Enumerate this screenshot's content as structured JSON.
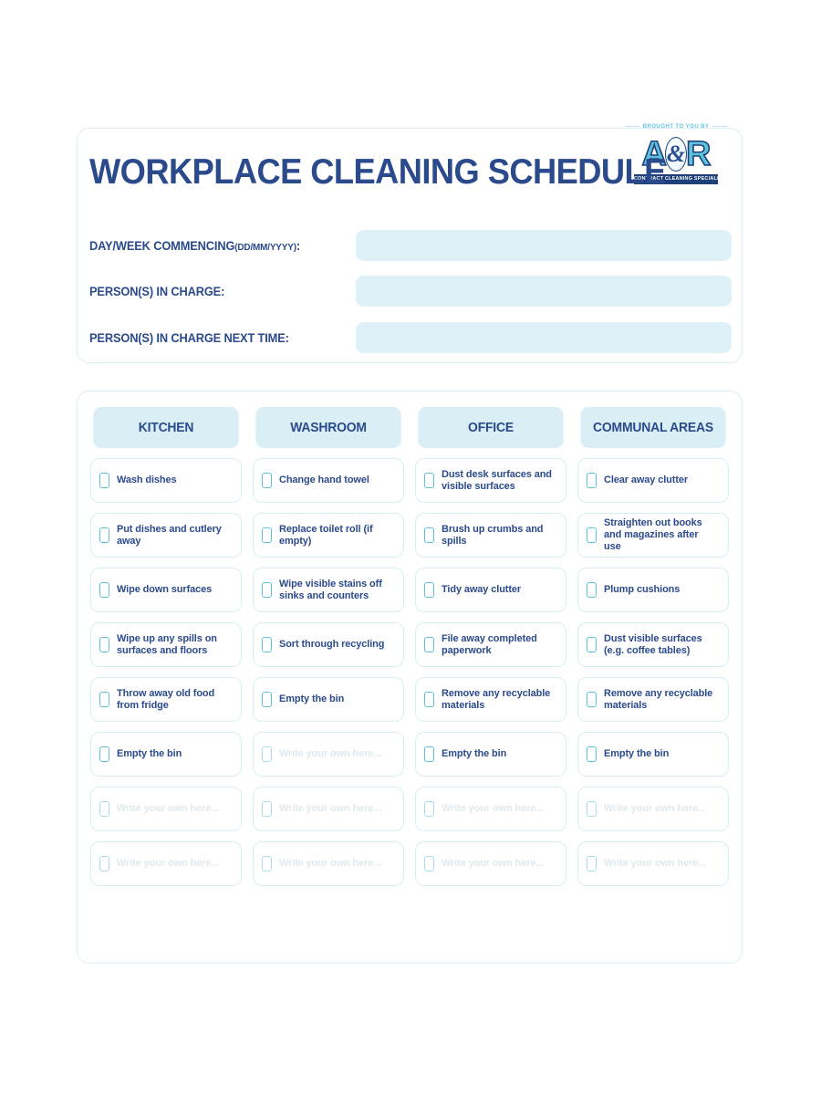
{
  "header": {
    "title": "WORKPLACE CLEANING SCHEDULE",
    "brought_to_you_by": "BROUGHT TO YOU BY",
    "logo": {
      "letter_left": "A",
      "ampersand": "&",
      "letter_right": "R",
      "tagline": "CONTRACT CLEANING SPECIALISTS"
    }
  },
  "form": {
    "fields": [
      {
        "label": "DAY/WEEK COMMENCING",
        "hint": "(DD/MM/YYYY)",
        "suffix": ":",
        "value": "",
        "placeholder": ""
      },
      {
        "label": "PERSON(S) IN CHARGE",
        "hint": "",
        "suffix": ":",
        "value": "",
        "placeholder": ""
      },
      {
        "label": "PERSON(S) IN CHARGE NEXT TIME",
        "hint": "",
        "suffix": ":",
        "value": "",
        "placeholder": ""
      }
    ]
  },
  "placeholder_text": "Write your own here...",
  "checklist": {
    "columns": [
      {
        "header": "KITCHEN",
        "tasks": [
          {
            "label": "Wash dishes",
            "is_placeholder": false
          },
          {
            "label": "Put dishes and cutlery away",
            "is_placeholder": false
          },
          {
            "label": "Wipe down surfaces",
            "is_placeholder": false
          },
          {
            "label": "Wipe up any spills on surfaces and floors",
            "is_placeholder": false
          },
          {
            "label": "Throw away old food from fridge",
            "is_placeholder": false
          },
          {
            "label": "Empty the bin",
            "is_placeholder": false
          },
          {
            "label": "Write your own here...",
            "is_placeholder": true
          },
          {
            "label": "Write your own here...",
            "is_placeholder": true
          }
        ]
      },
      {
        "header": "WASHROOM",
        "tasks": [
          {
            "label": "Change hand towel",
            "is_placeholder": false
          },
          {
            "label": "Replace toilet roll (if empty)",
            "is_placeholder": false
          },
          {
            "label": "Wipe visible stains off sinks and counters",
            "is_placeholder": false
          },
          {
            "label": "Sort through recycling",
            "is_placeholder": false
          },
          {
            "label": "Empty the bin",
            "is_placeholder": false
          },
          {
            "label": "Write your own here...",
            "is_placeholder": true
          },
          {
            "label": "Write your own here...",
            "is_placeholder": true
          },
          {
            "label": "Write your own here...",
            "is_placeholder": true
          }
        ]
      },
      {
        "header": "OFFICE",
        "tasks": [
          {
            "label": "Dust desk surfaces and visible surfaces",
            "is_placeholder": false
          },
          {
            "label": "Brush up crumbs and spills",
            "is_placeholder": false
          },
          {
            "label": "Tidy away clutter",
            "is_placeholder": false
          },
          {
            "label": "File away completed paperwork",
            "is_placeholder": false
          },
          {
            "label": "Remove any recyclable materials",
            "is_placeholder": false
          },
          {
            "label": "Empty the bin",
            "is_placeholder": false
          },
          {
            "label": "Write your own here...",
            "is_placeholder": true
          },
          {
            "label": "Write your own here...",
            "is_placeholder": true
          }
        ]
      },
      {
        "header": "COMMUNAL AREAS",
        "tasks": [
          {
            "label": "Clear away clutter",
            "is_placeholder": false
          },
          {
            "label": "Straighten out books and magazines after use",
            "is_placeholder": false
          },
          {
            "label": "Plump cushions",
            "is_placeholder": false
          },
          {
            "label": "Dust visible surfaces (e.g. coffee tables)",
            "is_placeholder": false
          },
          {
            "label": "Remove any recyclable materials",
            "is_placeholder": false
          },
          {
            "label": "Empty the bin",
            "is_placeholder": false
          },
          {
            "label": "Write your own here...",
            "is_placeholder": true
          },
          {
            "label": "Write your own here...",
            "is_placeholder": true
          }
        ]
      }
    ]
  },
  "colors": {
    "navy": "#2b4a8c",
    "cyan": "#5bc0da",
    "panel_border": "#daeef5",
    "field_fill": "#ddf1f7",
    "header_fill": "#d9eff5",
    "placeholder_grey": "#dfe9ef"
  }
}
